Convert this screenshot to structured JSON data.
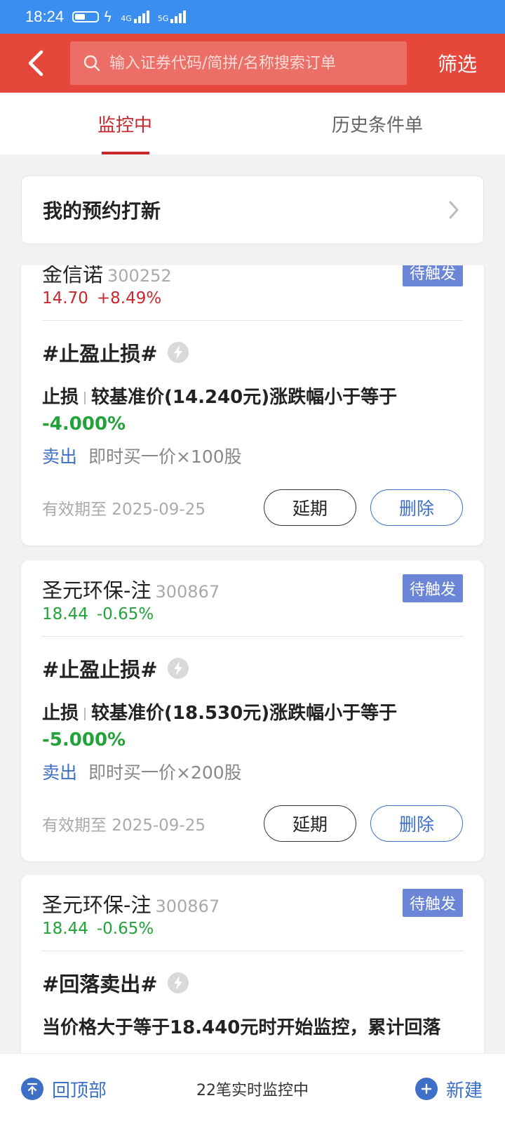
{
  "status_bar": {
    "time": "18:24",
    "net1": "4G",
    "net2": "5G"
  },
  "header": {
    "search_placeholder": "输入证券代码/简拼/名称搜索订单",
    "filter_label": "筛选"
  },
  "tabs": [
    {
      "label": "监控中",
      "active": true
    },
    {
      "label": "历史条件单",
      "active": false
    }
  ],
  "reserve": {
    "label": "我的预约打新"
  },
  "cards": [
    {
      "name": "金信诺",
      "code": "300252",
      "badge": "待触发",
      "price": "14.70",
      "change": "+8.49%",
      "trend": "up",
      "rule": "#止盈止损#",
      "cond_type": "止损",
      "cond_text": "较基准价(14.240元)涨跌幅小于等于",
      "cond_pct": "-4.000%",
      "action_side": "卖出",
      "action_text": "即时买一价×100股",
      "valid": "有效期至 2025-09-25",
      "extend_label": "延期",
      "delete_label": "删除"
    },
    {
      "name": "圣元环保-注",
      "code": "300867",
      "badge": "待触发",
      "price": "18.44",
      "change": "-0.65%",
      "trend": "down",
      "rule": "#止盈止损#",
      "cond_type": "止损",
      "cond_text": "较基准价(18.530元)涨跌幅小于等于",
      "cond_pct": "-5.000%",
      "action_side": "卖出",
      "action_text": "即时买一价×200股",
      "valid": "有效期至 2025-09-25",
      "extend_label": "延期",
      "delete_label": "删除"
    },
    {
      "name": "圣元环保-注",
      "code": "300867",
      "badge": "待触发",
      "price": "18.44",
      "change": "-0.65%",
      "trend": "down",
      "rule": "#回落卖出#",
      "cond_text": "当价格大于等于18.440元时开始监控，累计回落"
    }
  ],
  "bottom": {
    "top_label": "回顶部",
    "monitor_text": "22笔实时监控中",
    "new_label": "新建"
  },
  "colors": {
    "brand_red": "#e6473b",
    "up": "#c8282d",
    "down": "#22a33a",
    "link_blue": "#3d6fc7",
    "badge": "#6b86d6"
  }
}
